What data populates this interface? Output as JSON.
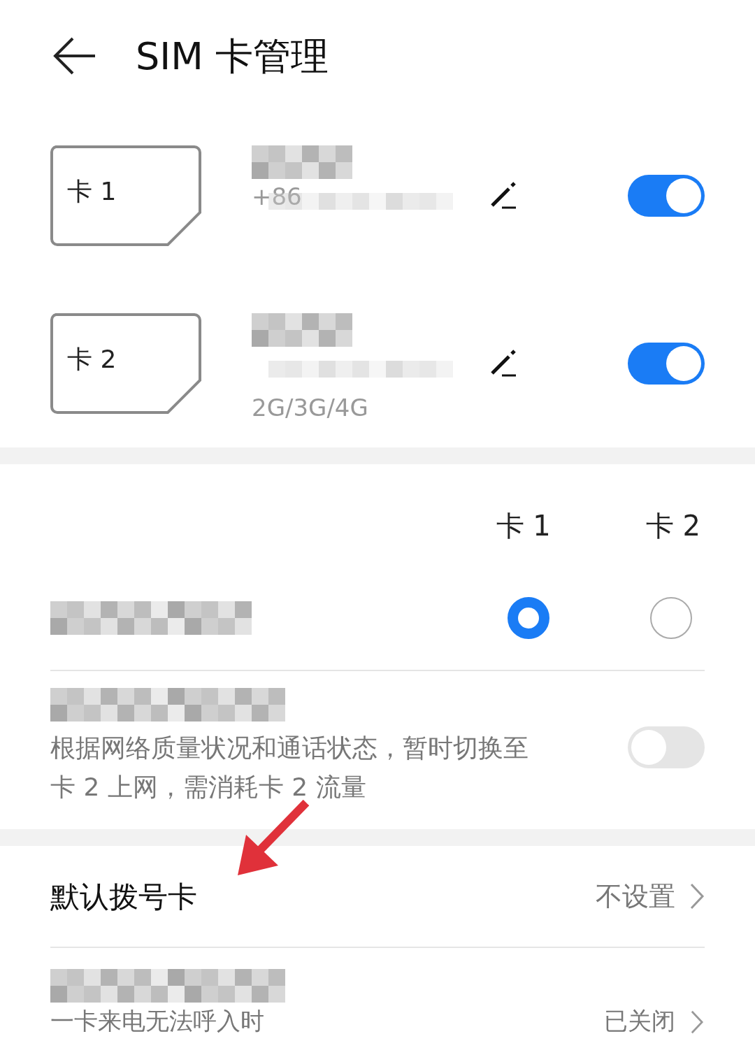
{
  "header": {
    "title": "SIM 卡管理"
  },
  "sim_cards": [
    {
      "label": "卡 1",
      "number": "+86",
      "on": true
    },
    {
      "label": "卡 2",
      "network": "2G/3G/4G",
      "on": true
    }
  ],
  "data_columns": [
    "卡 1",
    "卡 2"
  ],
  "default_data": {
    "options": [
      {
        "selected": true
      },
      {
        "selected": false
      }
    ]
  },
  "smart_switch": {
    "description": "根据网络质量状况和通话状态，暂时切换至卡 2 上网，需消耗卡 2 流量",
    "on": false
  },
  "default_dial": {
    "label": "默认拨号卡",
    "value": "不设置"
  },
  "call_forward": {
    "description": "一卡来电无法呼入时",
    "value": "已关闭"
  }
}
